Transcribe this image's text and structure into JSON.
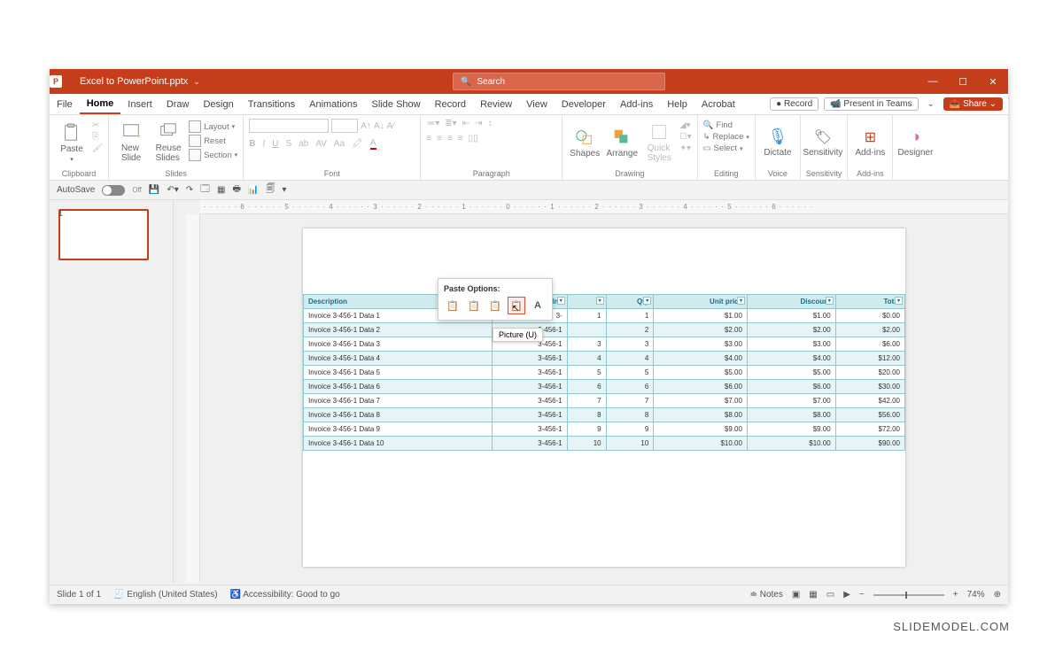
{
  "title": {
    "filename": "Excel to PowerPoint.pptx",
    "search_placeholder": "Search"
  },
  "winbtns": {
    "min": "—",
    "max": "☐",
    "close": "✕"
  },
  "tabs": [
    "File",
    "Home",
    "Insert",
    "Draw",
    "Design",
    "Transitions",
    "Animations",
    "Slide Show",
    "Record",
    "Review",
    "View",
    "Developer",
    "Add-ins",
    "Help",
    "Acrobat"
  ],
  "tabs_right": {
    "record": "● Record",
    "teams": "📹 Present in Teams",
    "share": "Share"
  },
  "ribbon": {
    "clipboard": {
      "paste": "Paste",
      "label": "Clipboard"
    },
    "slides": {
      "new": "New\nSlide",
      "reuse": "Reuse\nSlides",
      "layout": "Layout",
      "reset": "Reset",
      "section": "Section",
      "label": "Slides"
    },
    "font": {
      "label": "Font"
    },
    "paragraph": {
      "label": "Paragraph"
    },
    "drawing": {
      "shapes": "Shapes",
      "arrange": "Arrange",
      "quick": "Quick\nStyles",
      "label": "Drawing"
    },
    "editing": {
      "find": "Find",
      "replace": "Replace",
      "select": "Select",
      "label": "Editing"
    },
    "voice": {
      "dictate": "Dictate",
      "label": "Voice"
    },
    "sensitivity": {
      "sensitivity": "Sensitivity",
      "label": "Sensitivity"
    },
    "addins": {
      "addins": "Add-ins",
      "label": "Add-ins"
    },
    "designer": {
      "designer": "Designer"
    }
  },
  "qat": {
    "autosave": "AutoSave",
    "off": "Off"
  },
  "thumbs": {
    "slide1_num": "1"
  },
  "paste_popup": {
    "title": "Paste Options:",
    "tooltip": "Picture (U)"
  },
  "table": {
    "headers": [
      "Description",
      "Inv",
      "",
      "Qty",
      "Unit price",
      "Discount",
      "Total"
    ],
    "rows": [
      [
        "Invoice 3-456-1 Data 1",
        "3-",
        "1",
        "1",
        "$1.00",
        "$1.00",
        "$0.00"
      ],
      [
        "Invoice 3-456-1 Data 2",
        "3-456-1",
        "",
        "2",
        "$2.00",
        "$2.00",
        "$2.00"
      ],
      [
        "Invoice 3-456-1 Data 3",
        "3-456-1",
        "3",
        "3",
        "$3.00",
        "$3.00",
        "$6.00"
      ],
      [
        "Invoice 3-456-1 Data 4",
        "3-456-1",
        "4",
        "4",
        "$4.00",
        "$4.00",
        "$12.00"
      ],
      [
        "Invoice 3-456-1 Data 5",
        "3-456-1",
        "5",
        "5",
        "$5.00",
        "$5.00",
        "$20.00"
      ],
      [
        "Invoice 3-456-1 Data 6",
        "3-456-1",
        "6",
        "6",
        "$6.00",
        "$6.00",
        "$30.00"
      ],
      [
        "Invoice 3-456-1 Data 7",
        "3-456-1",
        "7",
        "7",
        "$7.00",
        "$7.00",
        "$42.00"
      ],
      [
        "Invoice 3-456-1 Data 8",
        "3-456-1",
        "8",
        "8",
        "$8.00",
        "$8.00",
        "$56.00"
      ],
      [
        "Invoice 3-456-1 Data 9",
        "3-456-1",
        "9",
        "9",
        "$9.00",
        "$9.00",
        "$72.00"
      ],
      [
        "Invoice 3-456-1 Data 10",
        "3-456-1",
        "10",
        "10",
        "$10.00",
        "$10.00",
        "$90.00"
      ]
    ]
  },
  "status": {
    "slide": "Slide 1 of 1",
    "lang": "English (United States)",
    "access": "Accessibility: Good to go",
    "notes": "Notes",
    "zoom": "74%"
  },
  "watermark": "SLIDEMODEL.COM",
  "ruler": "· · · · · · 6 · · · · · · 5 · · · · · · 4 · · · · · · 3 · · · · · · 2 · · · · · · 1 · · · · · · 0 · · · · · · 1 · · · · · · 2 · · · · · · 3 · · · · · · 4 · · · · · · 5 · · · · · · 6 · · · · · ·"
}
